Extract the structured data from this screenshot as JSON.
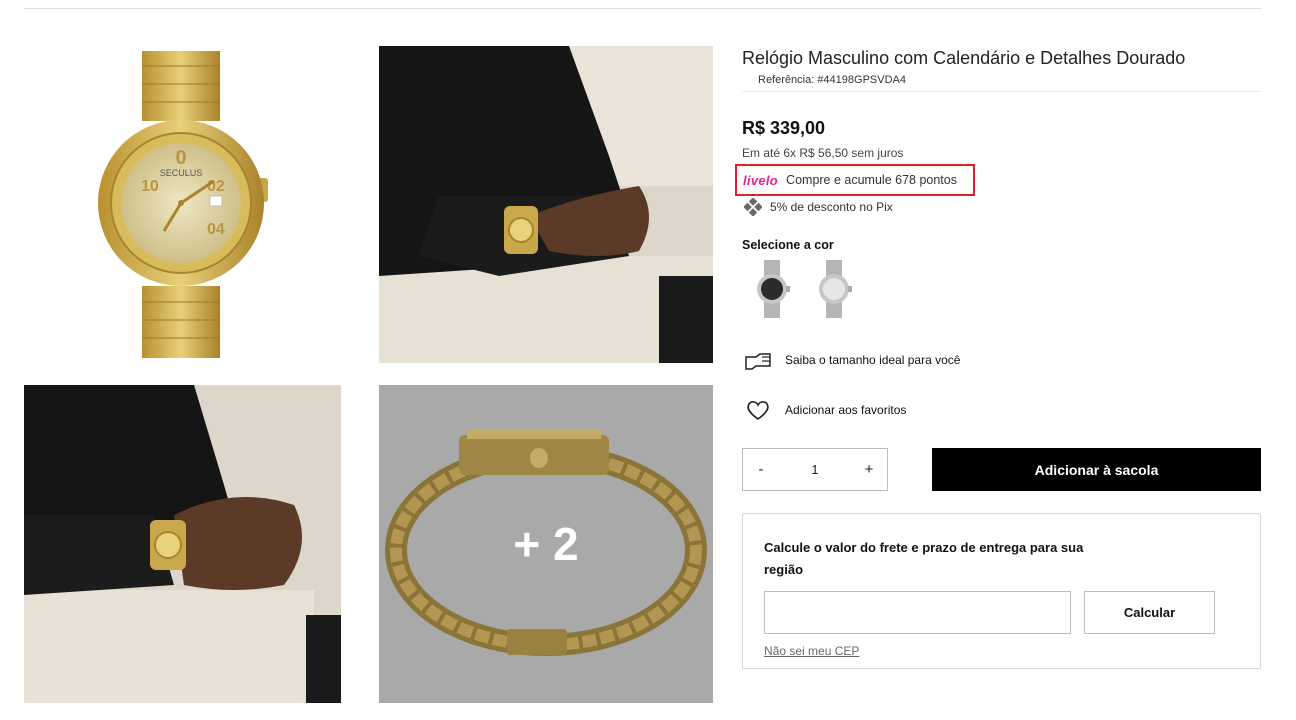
{
  "product": {
    "title": "Relógio Masculino com Calendário e Detalhes Dourado",
    "reference": "Referência: #44198GPSVDA4",
    "price": "R$ 339,00",
    "installments": "Em até 6x R$ 56,50 sem juros",
    "livelo": {
      "logo": "livelo",
      "text": "Compre e acumule 678 pontos"
    },
    "pix": {
      "icon": "pix-icon",
      "text": "5% de desconto no Pix"
    },
    "color_label": "Selecione a cor",
    "color_options": [
      "black-dial-watch",
      "silver-dial-watch"
    ],
    "size_guide": {
      "icon": "hand-measure-icon",
      "text": "Saiba o tamanho ideal para você"
    },
    "favorites": {
      "icon": "heart-icon",
      "text": "Adicionar aos favoritos"
    }
  },
  "gallery": {
    "images": [
      "gold-watch-front",
      "model-wrist-photo",
      "model-wrist-photo-2",
      "gold-watch-side"
    ],
    "more_overlay": "+ 2"
  },
  "cart": {
    "qty_minus": "-",
    "qty_value": "1",
    "qty_plus": "+",
    "add_label": "Adicionar à sacola"
  },
  "shipping": {
    "title": "Calcule o valor do frete e prazo de entrega para sua região",
    "input_placeholder": "",
    "button_label": "Calcular",
    "link_label": "Não sei meu CEP"
  },
  "colors": {
    "highlight_border": "#e0202a",
    "livelo_pink": "#e8248a",
    "button_black": "#000000",
    "gold": "#c9a84c"
  }
}
